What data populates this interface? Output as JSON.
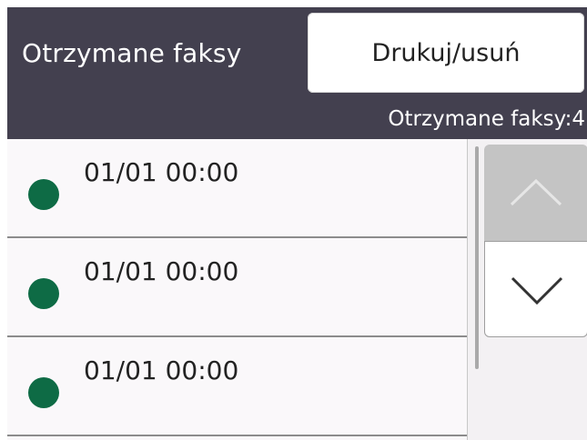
{
  "header": {
    "title": "Otrzymane faksy",
    "print_delete_label": "Drukuj/usuń",
    "count_label": "Otrzymane faksy:4"
  },
  "fax_list": [
    {
      "time": "01/01 00:00",
      "status_icon": "green-dot-icon"
    },
    {
      "time": "01/01 00:00",
      "status_icon": "green-dot-icon"
    },
    {
      "time": "01/01 00:00",
      "status_icon": "green-dot-icon"
    }
  ],
  "scroll": {
    "up_icon": "chevron-up-icon",
    "down_icon": "chevron-down-icon"
  },
  "colors": {
    "header_bg": "#43404f",
    "status_dot": "#0e6b45",
    "scroll_up_disabled": "#c4c4c4"
  }
}
